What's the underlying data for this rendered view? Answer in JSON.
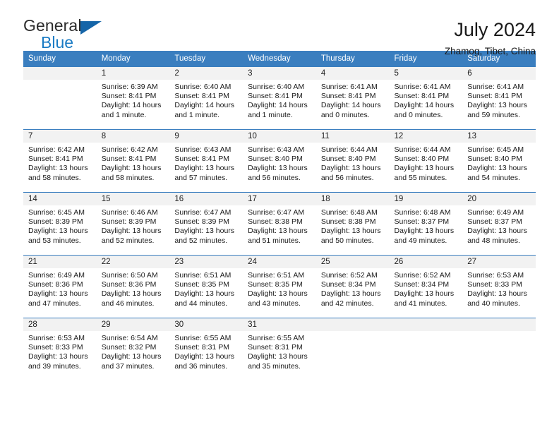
{
  "brand": {
    "line1": "General",
    "line2": "Blue",
    "triangle_color": "#1565a8",
    "blue_color": "#1a7bc4"
  },
  "header": {
    "title": "July 2024",
    "location": "Zhamog, Tibet, China"
  },
  "theme": {
    "header_blue": "#3a7ebf",
    "daynum_band": "#f2f2f2"
  },
  "weekdays": [
    "Sunday",
    "Monday",
    "Tuesday",
    "Wednesday",
    "Thursday",
    "Friday",
    "Saturday"
  ],
  "weeks": [
    [
      {
        "empty": true
      },
      {
        "day": "1",
        "sunrise": "Sunrise: 6:39 AM",
        "sunset": "Sunset: 8:41 PM",
        "daylight_1": "Daylight: 14 hours",
        "daylight_2": "and 1 minute."
      },
      {
        "day": "2",
        "sunrise": "Sunrise: 6:40 AM",
        "sunset": "Sunset: 8:41 PM",
        "daylight_1": "Daylight: 14 hours",
        "daylight_2": "and 1 minute."
      },
      {
        "day": "3",
        "sunrise": "Sunrise: 6:40 AM",
        "sunset": "Sunset: 8:41 PM",
        "daylight_1": "Daylight: 14 hours",
        "daylight_2": "and 1 minute."
      },
      {
        "day": "4",
        "sunrise": "Sunrise: 6:41 AM",
        "sunset": "Sunset: 8:41 PM",
        "daylight_1": "Daylight: 14 hours",
        "daylight_2": "and 0 minutes."
      },
      {
        "day": "5",
        "sunrise": "Sunrise: 6:41 AM",
        "sunset": "Sunset: 8:41 PM",
        "daylight_1": "Daylight: 14 hours",
        "daylight_2": "and 0 minutes."
      },
      {
        "day": "6",
        "sunrise": "Sunrise: 6:41 AM",
        "sunset": "Sunset: 8:41 PM",
        "daylight_1": "Daylight: 13 hours",
        "daylight_2": "and 59 minutes."
      }
    ],
    [
      {
        "day": "7",
        "sunrise": "Sunrise: 6:42 AM",
        "sunset": "Sunset: 8:41 PM",
        "daylight_1": "Daylight: 13 hours",
        "daylight_2": "and 58 minutes."
      },
      {
        "day": "8",
        "sunrise": "Sunrise: 6:42 AM",
        "sunset": "Sunset: 8:41 PM",
        "daylight_1": "Daylight: 13 hours",
        "daylight_2": "and 58 minutes."
      },
      {
        "day": "9",
        "sunrise": "Sunrise: 6:43 AM",
        "sunset": "Sunset: 8:41 PM",
        "daylight_1": "Daylight: 13 hours",
        "daylight_2": "and 57 minutes."
      },
      {
        "day": "10",
        "sunrise": "Sunrise: 6:43 AM",
        "sunset": "Sunset: 8:40 PM",
        "daylight_1": "Daylight: 13 hours",
        "daylight_2": "and 56 minutes."
      },
      {
        "day": "11",
        "sunrise": "Sunrise: 6:44 AM",
        "sunset": "Sunset: 8:40 PM",
        "daylight_1": "Daylight: 13 hours",
        "daylight_2": "and 56 minutes."
      },
      {
        "day": "12",
        "sunrise": "Sunrise: 6:44 AM",
        "sunset": "Sunset: 8:40 PM",
        "daylight_1": "Daylight: 13 hours",
        "daylight_2": "and 55 minutes."
      },
      {
        "day": "13",
        "sunrise": "Sunrise: 6:45 AM",
        "sunset": "Sunset: 8:40 PM",
        "daylight_1": "Daylight: 13 hours",
        "daylight_2": "and 54 minutes."
      }
    ],
    [
      {
        "day": "14",
        "sunrise": "Sunrise: 6:45 AM",
        "sunset": "Sunset: 8:39 PM",
        "daylight_1": "Daylight: 13 hours",
        "daylight_2": "and 53 minutes."
      },
      {
        "day": "15",
        "sunrise": "Sunrise: 6:46 AM",
        "sunset": "Sunset: 8:39 PM",
        "daylight_1": "Daylight: 13 hours",
        "daylight_2": "and 52 minutes."
      },
      {
        "day": "16",
        "sunrise": "Sunrise: 6:47 AM",
        "sunset": "Sunset: 8:39 PM",
        "daylight_1": "Daylight: 13 hours",
        "daylight_2": "and 52 minutes."
      },
      {
        "day": "17",
        "sunrise": "Sunrise: 6:47 AM",
        "sunset": "Sunset: 8:38 PM",
        "daylight_1": "Daylight: 13 hours",
        "daylight_2": "and 51 minutes."
      },
      {
        "day": "18",
        "sunrise": "Sunrise: 6:48 AM",
        "sunset": "Sunset: 8:38 PM",
        "daylight_1": "Daylight: 13 hours",
        "daylight_2": "and 50 minutes."
      },
      {
        "day": "19",
        "sunrise": "Sunrise: 6:48 AM",
        "sunset": "Sunset: 8:37 PM",
        "daylight_1": "Daylight: 13 hours",
        "daylight_2": "and 49 minutes."
      },
      {
        "day": "20",
        "sunrise": "Sunrise: 6:49 AM",
        "sunset": "Sunset: 8:37 PM",
        "daylight_1": "Daylight: 13 hours",
        "daylight_2": "and 48 minutes."
      }
    ],
    [
      {
        "day": "21",
        "sunrise": "Sunrise: 6:49 AM",
        "sunset": "Sunset: 8:36 PM",
        "daylight_1": "Daylight: 13 hours",
        "daylight_2": "and 47 minutes."
      },
      {
        "day": "22",
        "sunrise": "Sunrise: 6:50 AM",
        "sunset": "Sunset: 8:36 PM",
        "daylight_1": "Daylight: 13 hours",
        "daylight_2": "and 46 minutes."
      },
      {
        "day": "23",
        "sunrise": "Sunrise: 6:51 AM",
        "sunset": "Sunset: 8:35 PM",
        "daylight_1": "Daylight: 13 hours",
        "daylight_2": "and 44 minutes."
      },
      {
        "day": "24",
        "sunrise": "Sunrise: 6:51 AM",
        "sunset": "Sunset: 8:35 PM",
        "daylight_1": "Daylight: 13 hours",
        "daylight_2": "and 43 minutes."
      },
      {
        "day": "25",
        "sunrise": "Sunrise: 6:52 AM",
        "sunset": "Sunset: 8:34 PM",
        "daylight_1": "Daylight: 13 hours",
        "daylight_2": "and 42 minutes."
      },
      {
        "day": "26",
        "sunrise": "Sunrise: 6:52 AM",
        "sunset": "Sunset: 8:34 PM",
        "daylight_1": "Daylight: 13 hours",
        "daylight_2": "and 41 minutes."
      },
      {
        "day": "27",
        "sunrise": "Sunrise: 6:53 AM",
        "sunset": "Sunset: 8:33 PM",
        "daylight_1": "Daylight: 13 hours",
        "daylight_2": "and 40 minutes."
      }
    ],
    [
      {
        "day": "28",
        "sunrise": "Sunrise: 6:53 AM",
        "sunset": "Sunset: 8:33 PM",
        "daylight_1": "Daylight: 13 hours",
        "daylight_2": "and 39 minutes."
      },
      {
        "day": "29",
        "sunrise": "Sunrise: 6:54 AM",
        "sunset": "Sunset: 8:32 PM",
        "daylight_1": "Daylight: 13 hours",
        "daylight_2": "and 37 minutes."
      },
      {
        "day": "30",
        "sunrise": "Sunrise: 6:55 AM",
        "sunset": "Sunset: 8:31 PM",
        "daylight_1": "Daylight: 13 hours",
        "daylight_2": "and 36 minutes."
      },
      {
        "day": "31",
        "sunrise": "Sunrise: 6:55 AM",
        "sunset": "Sunset: 8:31 PM",
        "daylight_1": "Daylight: 13 hours",
        "daylight_2": "and 35 minutes."
      },
      {
        "empty": true
      },
      {
        "empty": true
      },
      {
        "empty": true
      }
    ]
  ]
}
